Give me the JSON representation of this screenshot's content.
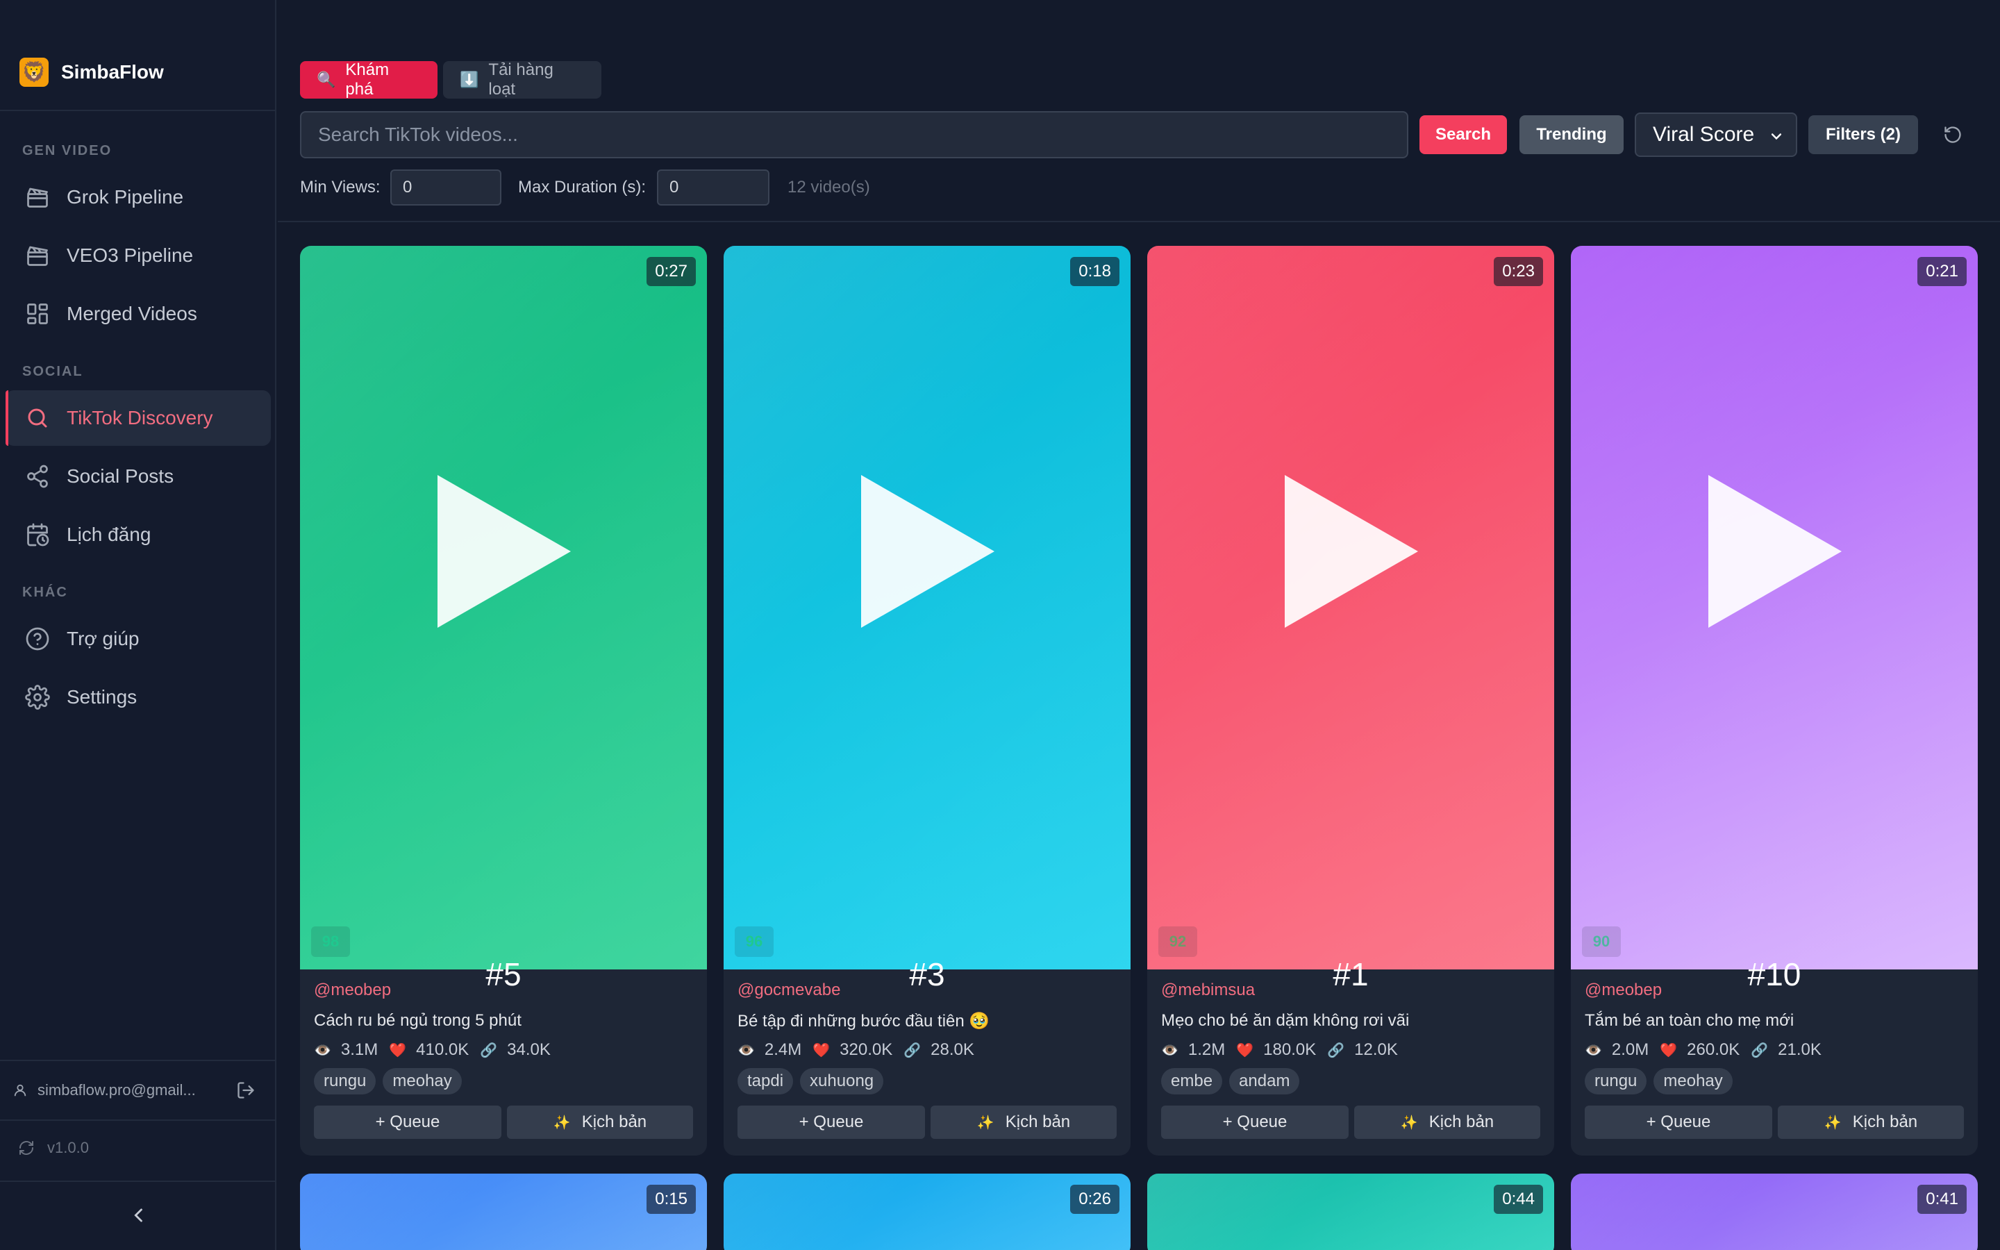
{
  "app": {
    "name": "SimbaFlow",
    "logo_glyph": "🦁",
    "accent": "#f43f5e"
  },
  "sidebar": {
    "sections": [
      {
        "label": "GEN VIDEO"
      },
      {
        "label": "SOCIAL"
      },
      {
        "label": "KHÁC"
      }
    ],
    "items": [
      {
        "label": "Grok Pipeline",
        "icon": "clapperboard-icon"
      },
      {
        "label": "VEO3 Pipeline",
        "icon": "clapperboard-icon"
      },
      {
        "label": "Merged Videos",
        "icon": "merge-grid-icon"
      },
      {
        "label": "TikTok Discovery",
        "icon": "search-icon",
        "active": true
      },
      {
        "label": "Social Posts",
        "icon": "share-icon"
      },
      {
        "label": "Lịch đăng",
        "icon": "calendar-clock-icon"
      },
      {
        "label": "Trợ giúp",
        "icon": "help-circle-icon"
      },
      {
        "label": "Settings",
        "icon": "gear-icon"
      }
    ],
    "account_email": "simbaflow.pro@gmail...",
    "version": "v1.0.0"
  },
  "header": {
    "tabs": [
      {
        "label": "Khám phá",
        "icon": "🔍",
        "active": true
      },
      {
        "label": "Tải hàng loạt",
        "icon": "⬇️",
        "active": false
      }
    ],
    "search_placeholder": "Search TikTok videos...",
    "search_value": "",
    "search_button": "Search",
    "trending_button": "Trending",
    "sort_value": "Viral Score",
    "filters_button": "Filters (2)",
    "min_views_label": "Min Views:",
    "min_views_value": "0",
    "max_duration_label": "Max Duration (s):",
    "max_duration_value": "0",
    "result_count": "12 video(s)"
  },
  "card_labels": {
    "queue": "+ Queue",
    "script": "Kịch bản",
    "script_icon": "✨",
    "views_icon": "👁️",
    "likes_icon": "❤️",
    "shares_icon": "🔗"
  },
  "videos": [
    {
      "duration": "0:27",
      "rank": "#5",
      "score": "98",
      "author": "@meobep",
      "caption": "Cách ru bé ngủ trong 5 phút",
      "views": "3.1M",
      "likes": "410.0K",
      "shares": "34.0K",
      "tags": [
        "rungu",
        "meohay"
      ],
      "color_from": "#10b981",
      "color_to": "#34d399",
      "score_color": "#1fc98f"
    },
    {
      "duration": "0:18",
      "rank": "#3",
      "score": "96",
      "author": "@gocmevabe",
      "caption": "Bé tập đi những bước đầu tiên 🥹",
      "views": "2.4M",
      "likes": "320.0K",
      "shares": "28.0K",
      "tags": [
        "tapdi",
        "xuhuong"
      ],
      "color_from": "#06b6d4",
      "color_to": "#22d3ee",
      "score_color": "#1fc98f"
    },
    {
      "duration": "0:23",
      "rank": "#1",
      "score": "92",
      "author": "@mebimsua",
      "caption": "Mẹo cho bé ăn dặm không rơi vãi",
      "views": "1.2M",
      "likes": "180.0K",
      "shares": "12.0K",
      "tags": [
        "embe",
        "andam"
      ],
      "color_from": "#f43f5e",
      "color_to": "#fb7185",
      "score_color": "#6f9a6a"
    },
    {
      "duration": "0:21",
      "rank": "#10",
      "score": "90",
      "author": "@meobep",
      "caption": "Tắm bé an toàn cho mẹ mới",
      "views": "2.0M",
      "likes": "260.0K",
      "shares": "21.0K",
      "tags": [
        "rungu",
        "meohay"
      ],
      "color_from": "#a855f7",
      "color_to": "#d8b4fe",
      "score_color": "#4fb6a0"
    },
    {
      "duration": "0:15",
      "color_from": "#3b82f6",
      "color_to": "#60a5fa"
    },
    {
      "duration": "0:26",
      "color_from": "#0ea5e9",
      "color_to": "#38bdf8"
    },
    {
      "duration": "0:44",
      "color_from": "#14b8a6",
      "color_to": "#2dd4bf"
    },
    {
      "duration": "0:41",
      "color_from": "#8b5cf6",
      "color_to": "#a78bfa"
    }
  ]
}
